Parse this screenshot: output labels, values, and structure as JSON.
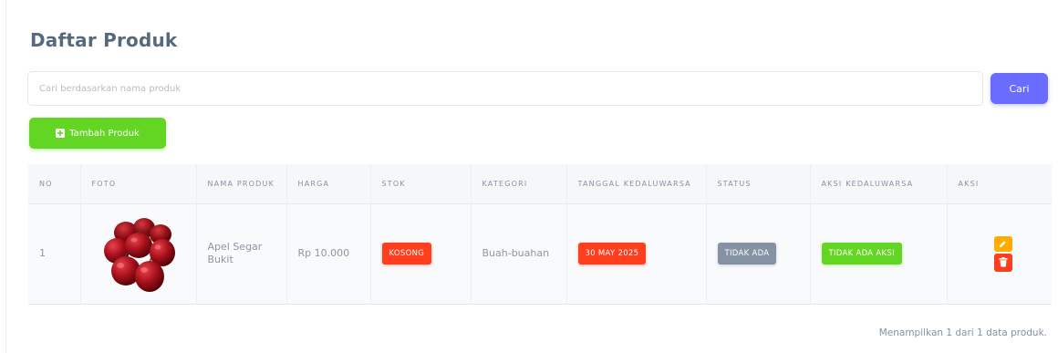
{
  "page": {
    "title": "Daftar Produk"
  },
  "search": {
    "placeholder": "Cari berdasarkan nama produk",
    "value": "",
    "button_label": "Cari"
  },
  "toolbar": {
    "add_label": "Tambah Produk",
    "add_icon": "plus-square-icon"
  },
  "table": {
    "headers": {
      "no": "NO",
      "foto": "FOTO",
      "nama": "NAMA PRODUK",
      "harga": "HARGA",
      "stok": "STOK",
      "kategori": "KATEGORI",
      "tanggal": "TANGGAL KEDALUWARSA",
      "status": "STATUS",
      "aksi_kedaluwarsa": "AKSI KEDALUWARSA",
      "aksi": "AKSI"
    },
    "rows": [
      {
        "no": "1",
        "foto_icon": "apple-photo",
        "nama": "Apel Segar Bukit",
        "harga": "Rp 10.000",
        "stok": "KOSONG",
        "kategori": "Buah-buahan",
        "tanggal": "30 MAY 2025",
        "status": "TIDAK ADA",
        "aksi_kedaluwarsa": "TIDAK ADA AKSI",
        "actions": [
          "edit-icon",
          "delete-icon"
        ]
      }
    ]
  },
  "footer": {
    "info": "Menampilkan 1 dari 1 data produk."
  },
  "colors": {
    "primary": "#696cff",
    "success": "#63d624",
    "danger": "#ff3e1d",
    "warning": "#ffab00",
    "secondary": "#8592a3"
  }
}
